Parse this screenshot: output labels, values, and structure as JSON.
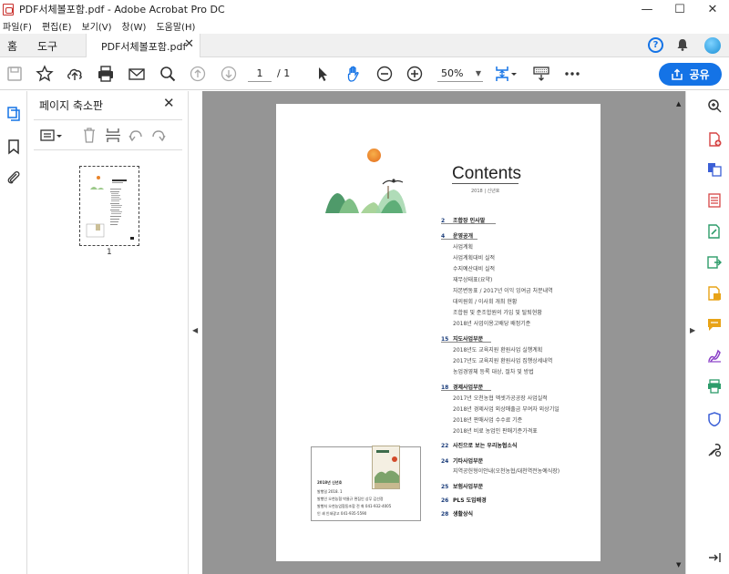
{
  "window": {
    "title": "PDF서체볼포함.pdf - Adobe Acrobat Pro DC",
    "minimize": "—",
    "maximize": "☐",
    "close": "✕"
  },
  "menu": [
    "파일(F)",
    "편집(E)",
    "보기(V)",
    "창(W)",
    "도움말(H)"
  ],
  "tabs": {
    "home": "홈",
    "tools": "도구",
    "document": "PDF서체볼포함.pdf"
  },
  "toolbar": {
    "page_current": "1",
    "page_total": "/ 1",
    "zoom": "50%",
    "share_label": "공유"
  },
  "panel": {
    "title": "페이지 축소판",
    "thumbnail_page_label": "1"
  },
  "pdf": {
    "title": "Contents",
    "subtitle": "2018 | 신년호",
    "toc": [
      {
        "num": "2",
        "head": "조합장 인사말",
        "items": []
      },
      {
        "num": "4",
        "head": "운영공개",
        "items": [
          "사업계획",
          "사업계획대비 실적",
          "수지예산대비 실적",
          "재무상태표(요약)",
          "자본변동표 / 2017년 이익 잉여금 처분내역",
          "대의원회 / 이사회 개최 현황",
          "조합원 및 준조합원의 가입 및 탈퇴현황",
          "2018년 사업이용고배당 배정기준"
        ]
      },
      {
        "num": "15",
        "head": "지도사업부문",
        "items": [
          "2018년도 교육지원 환원사업 실행계획",
          "2017년도 교육지원 환원사업 집행상세내역",
          "농업경영체 등록 대상, 절차 및 방법"
        ]
      },
      {
        "num": "18",
        "head": "경제사업부문",
        "items": [
          "2017년 오천농협 엑셋가공공장 사업실적",
          "2018년 경제사업 외상매출금 부여자 외상기일",
          "2018년 판매사업 수수료 기준",
          "2018년 비료 농업인 판매기준가격표"
        ]
      },
      {
        "num": "22",
        "head": "사진으로 보는 우리농협소식",
        "items": []
      },
      {
        "num": "24",
        "head": "기타사업부문",
        "items": [
          "지역공헌형이안내(오천농협/대천역전농예식장)"
        ]
      },
      {
        "num": "25",
        "head": "보험사업부문",
        "items": []
      },
      {
        "num": "26",
        "head": "PLS 도입배경",
        "items": []
      },
      {
        "num": "28",
        "head": "생활상식",
        "items": []
      }
    ],
    "imprint": {
      "issue": "2018년 신년호",
      "lines": [
        "발행일 2018. 1",
        "발행인 오천농협 박물규      편집인 상무 김선정",
        "발행처 오천농업협동조합      전   화 041-932-4005",
        "인   쇄 인쇄광고 041-935-5590"
      ]
    }
  },
  "colors": {
    "accent": "#1473E6",
    "viewport_bg": "#959595",
    "toc_number": "#1A3C7A"
  }
}
